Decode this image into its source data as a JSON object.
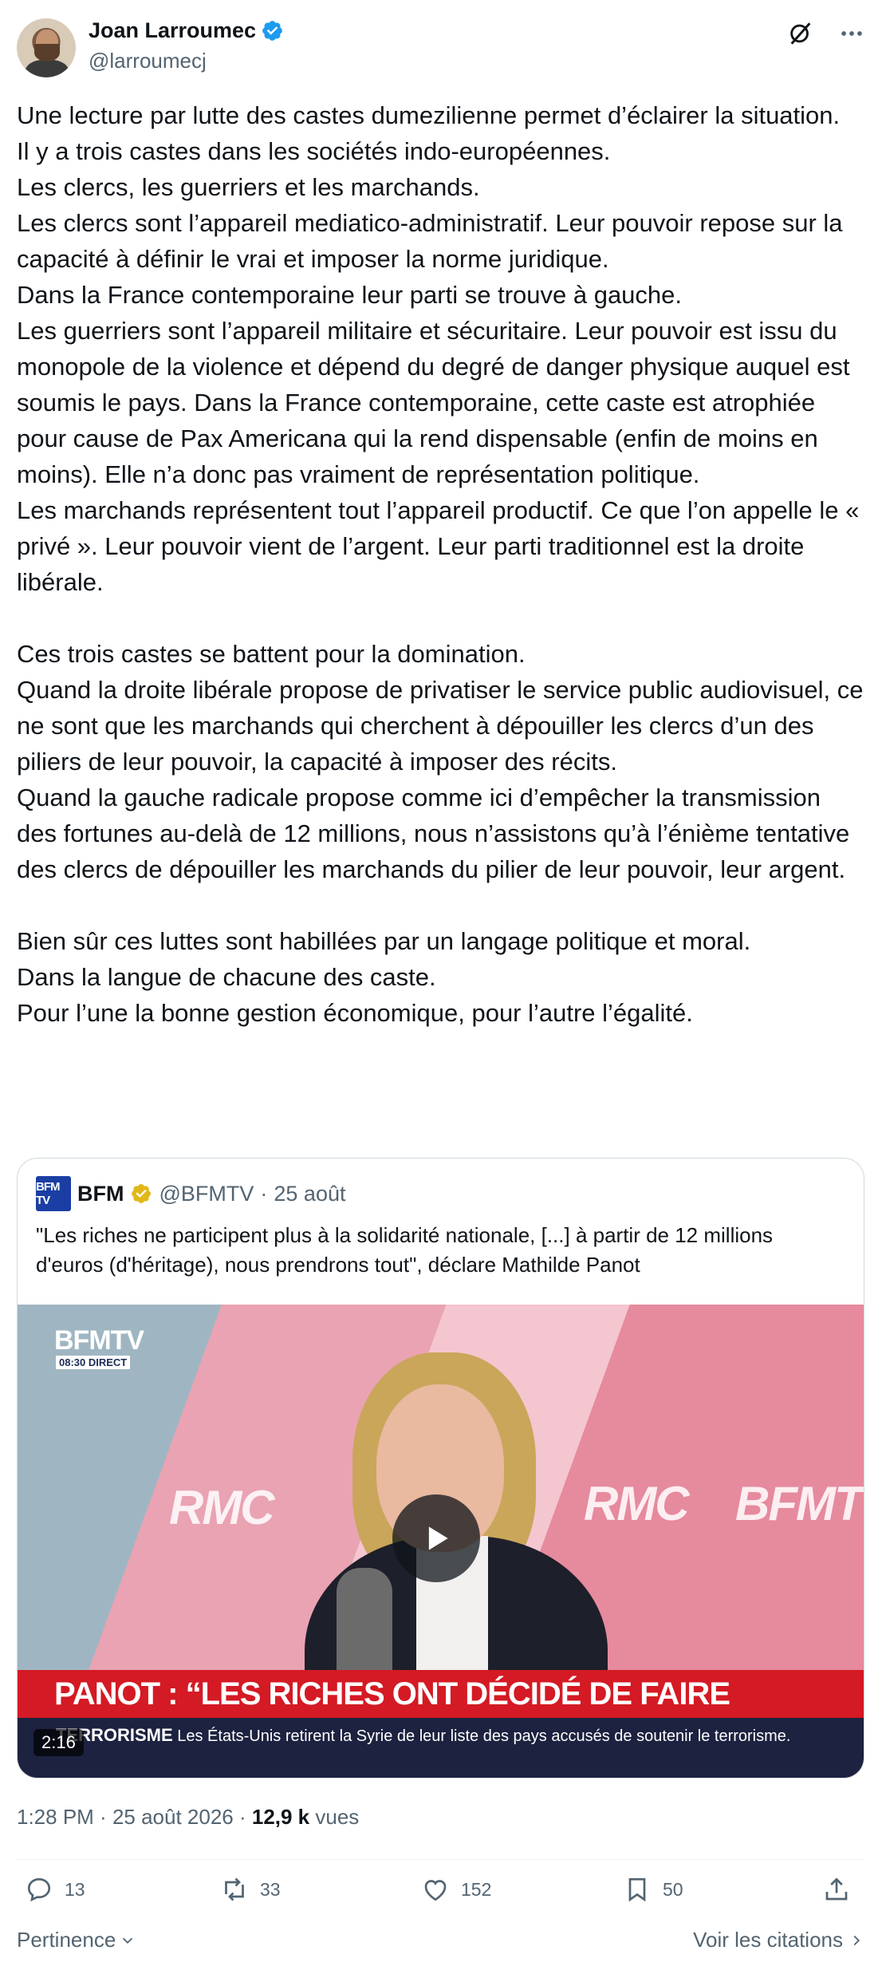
{
  "author": {
    "name": "Joan Larroumec",
    "handle": "@larroumecj"
  },
  "tweet": {
    "paragraphs": [
      "Une lecture par lutte des castes dumezilienne permet d’éclairer la situation.",
      "Il y a trois castes dans les sociétés indo-européennes.",
      "Les clercs, les guerriers et les marchands.",
      "Les clercs sont l’appareil mediatico-administratif. Leur pouvoir repose sur la capacité à définir le vrai et imposer la norme juridique.",
      "Dans la France contemporaine leur parti se trouve à gauche.",
      "Les guerriers sont l’appareil militaire et sécuritaire. Leur pouvoir est issu du monopole de la violence et dépend du degré de danger physique auquel est soumis le pays. Dans la France contemporaine, cette caste est atrophiée pour cause de Pax Americana qui la rend dispensable (enfin de moins en moins). Elle n’a donc pas vraiment de représentation politique.",
      "Les marchands représentent tout l’appareil productif. Ce que l’on appelle le « privé ». Leur pouvoir vient de l’argent. Leur parti traditionnel est la droite libérale.",
      "",
      "Ces trois castes se battent pour la domination.",
      "Quand la droite libérale propose de privatiser le service public audiovisuel, ce ne sont que les marchands qui cherchent à dépouiller les clercs d’un des piliers de leur pouvoir, la capacité à imposer des récits.",
      "Quand la gauche radicale propose comme ici d’empêcher la transmission des fortunes au-delà de 12 millions, nous n’assistons qu’à l’énième tentative des clercs de dépouiller les marchands du pilier de leur pouvoir, leur argent.",
      "",
      "Bien sûr ces luttes sont habillées par un langage politique et moral.",
      "Dans la langue de chacune des caste.",
      "Pour l’une la bonne gestion économique, pour l’autre l’égalité."
    ]
  },
  "quote": {
    "logo_text": "BFM TV",
    "name": "BFM",
    "handle": "@BFMTV",
    "separator": "·",
    "date": "25 août",
    "text": "\"Les riches ne participent plus à la solidarité nationale, [...] à partir de 12 millions d'euros (d'héritage), nous prendrons tout\", déclare Mathilde Panot",
    "video": {
      "brand": "BFMTV",
      "time_badge": "08:30 DIRECT",
      "watermark_1": "RMC",
      "watermark_2": "RMC",
      "watermark_3": "BFMTV",
      "banner": "PANOT : “LES RICHES ONT DÉCIDÉ DE FAIRE SÉCESSION”",
      "ticker_label": "TERRORISME",
      "ticker_text": "Les États-Unis retirent la Syrie de leur liste des pays accusés de soutenir le terrorisme.",
      "duration": "2:16"
    }
  },
  "meta": {
    "time": "1:28 PM",
    "separator": " · ",
    "date": "25 août 2026",
    "views_count": "12,9 k",
    "views_label": "vues"
  },
  "actions": {
    "replies": "13",
    "reposts": "33",
    "likes": "152",
    "bookmarks": "50"
  },
  "footer": {
    "sort_label": "Pertinence",
    "quotes_link": "Voir les citations"
  },
  "colors": {
    "text": "#0f1419",
    "secondary": "#536471",
    "verified": "#1d9bf0",
    "gold_verified": "#e2b719",
    "border": "#cfd9de"
  },
  "icons": [
    "verified-badge-icon",
    "grok-icon",
    "more-icon",
    "play-icon",
    "reply-icon",
    "repost-icon",
    "like-icon",
    "bookmark-icon",
    "share-icon",
    "chevron-down-icon",
    "chevron-right-icon"
  ]
}
